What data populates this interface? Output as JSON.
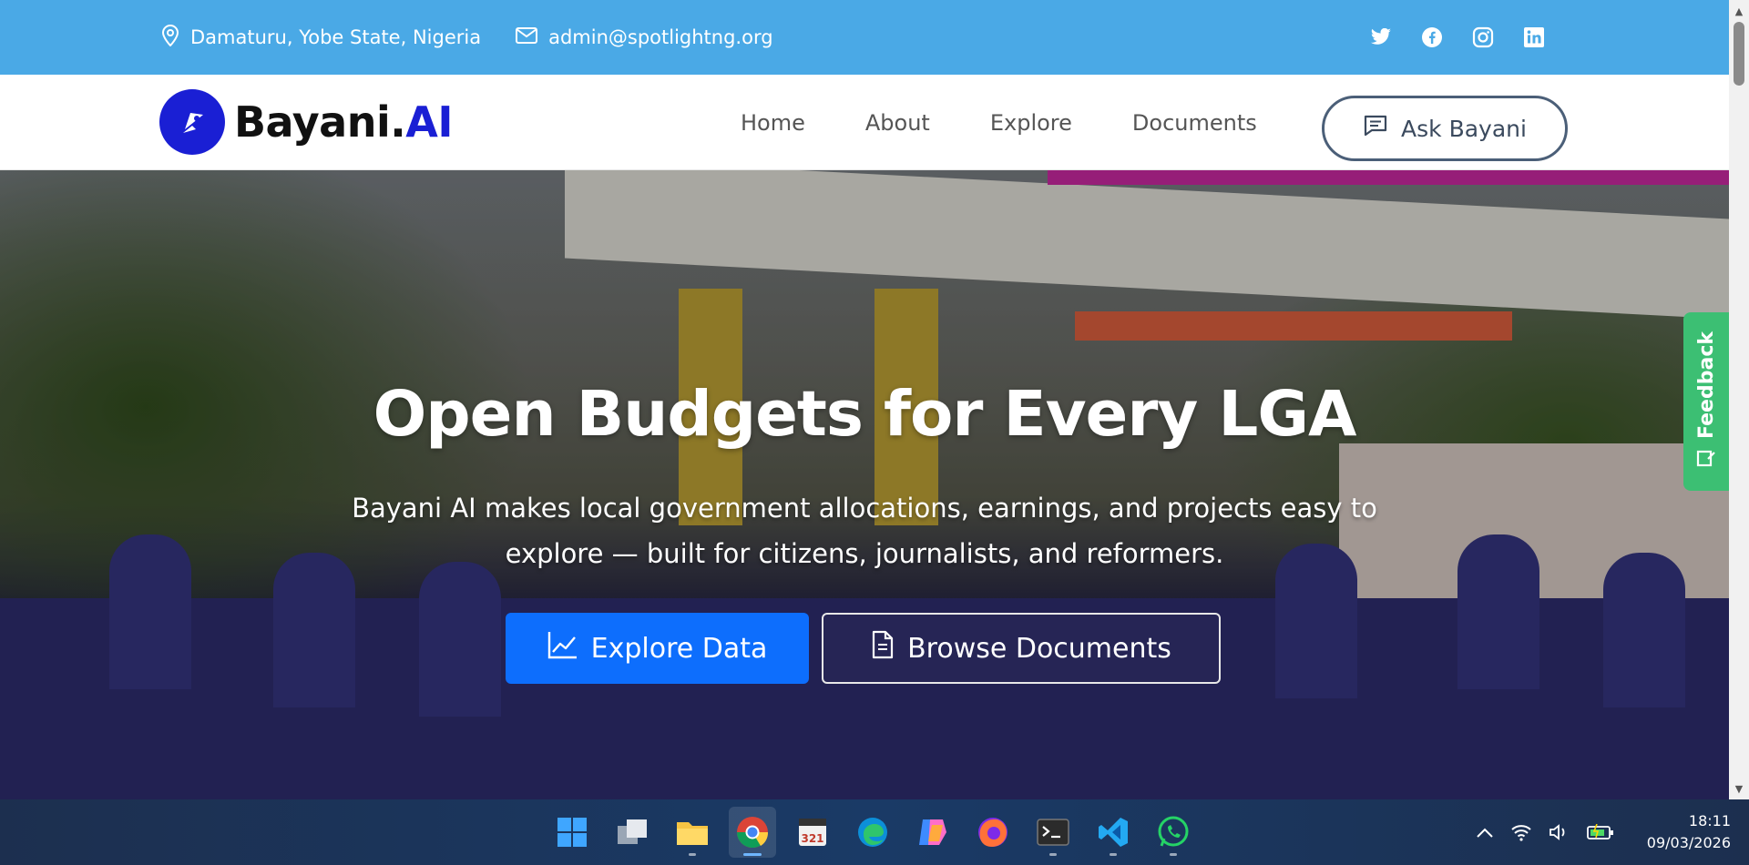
{
  "topbar": {
    "location": "Damaturu, Yobe State, Nigeria",
    "email": "admin@spotlightng.org",
    "social": [
      "twitter-icon",
      "facebook-icon",
      "instagram-icon",
      "linkedin-icon"
    ],
    "background": "#4aa9e6"
  },
  "navbar": {
    "brand_main": "Bayani.",
    "brand_accent": "AI",
    "brand_color": "#1a1fd4",
    "links": [
      "Home",
      "About",
      "Explore",
      "Documents"
    ],
    "cta": "Ask Bayani"
  },
  "hero": {
    "title": "Open Budgets for Every LGA",
    "subtitle": "Bayani AI makes local government allocations, earnings, and projects easy to explore — built for citizens, journalists, and reformers.",
    "primary_button": "Explore Data",
    "secondary_button": "Browse Documents",
    "primary_color": "#0d6efd"
  },
  "feedback": {
    "label": "Feedback",
    "color": "#3cbf73"
  },
  "taskbar": {
    "apps": [
      "windows-start-icon",
      "task-view-icon",
      "file-explorer-icon",
      "chrome-icon",
      "media-app-icon",
      "edge-icon",
      "copilot-icon",
      "firefox-icon",
      "terminal-icon",
      "vscode-icon",
      "whatsapp-icon"
    ],
    "active_app": "chrome-icon",
    "time": "18:11",
    "date": "09/03/2026"
  }
}
